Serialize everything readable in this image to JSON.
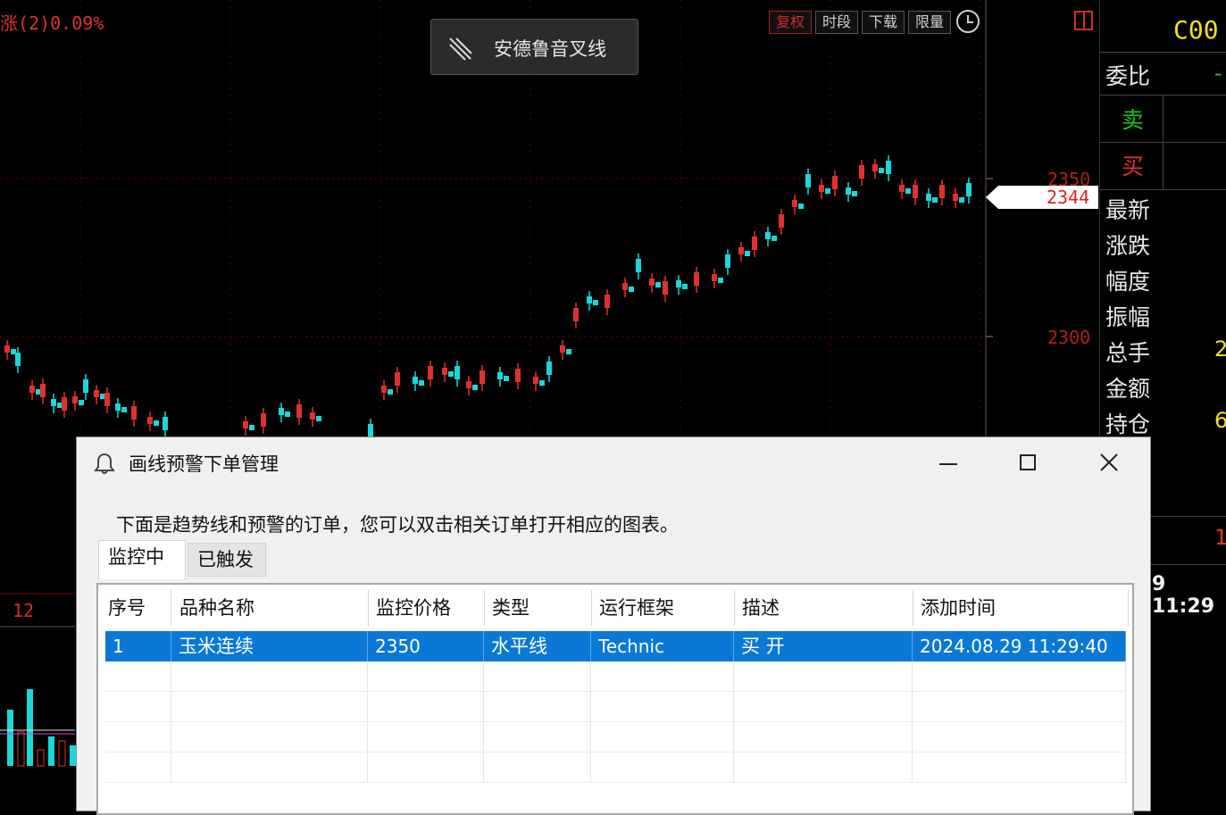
{
  "chart": {
    "header_text": "涨(2)0.09%",
    "toolbar": [
      "复权",
      "时段",
      "下载",
      "限量"
    ],
    "price_labels": [
      "2350",
      "2300"
    ],
    "current_price": "2344",
    "volume_label": "12",
    "tooltip": "安德鲁音叉线",
    "colors": {
      "up": "#e03030",
      "down": "#19d8d8",
      "grid": "#3a0000",
      "bg": "#000000"
    }
  },
  "right_panel": {
    "code": "C00",
    "labels": [
      "委比",
      "卖",
      "买",
      "最新",
      "涨跌",
      "幅度",
      "振幅",
      "总手",
      "金额",
      "持仓"
    ],
    "time": "9 11:29"
  },
  "dialog": {
    "title": "画线预警下单管理",
    "description": "下面是趋势线和预警的订单，您可以双击相关订单打开相应的图表。",
    "tabs": [
      "监控中",
      "已触发"
    ],
    "columns": [
      "序号",
      "品种名称",
      "监控价格",
      "类型",
      "运行框架",
      "描述",
      "添加时间"
    ],
    "rows": [
      [
        "1",
        "玉米连续",
        "2350",
        "水平线",
        "Technic",
        "买 开",
        "2024.08.29 11:29:40"
      ]
    ]
  }
}
